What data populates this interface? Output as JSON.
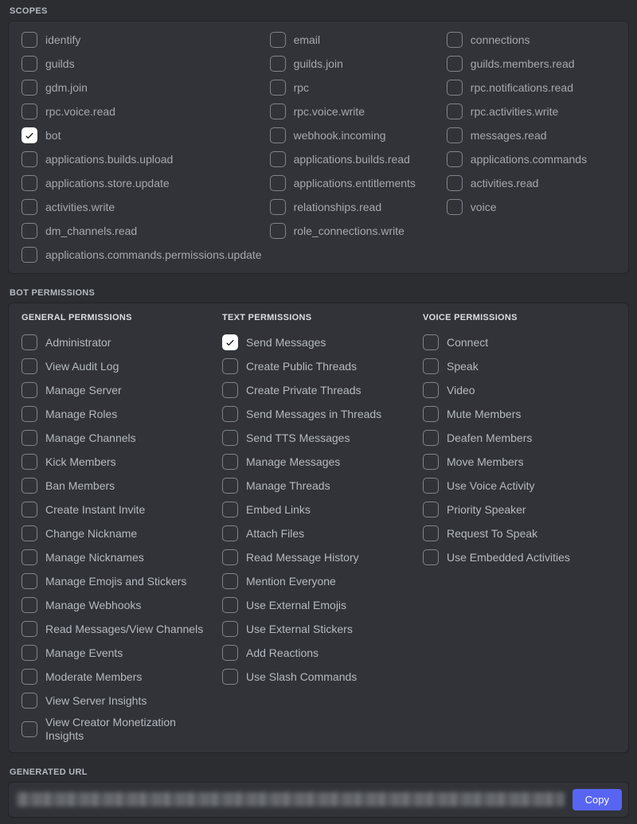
{
  "scopes": {
    "label": "SCOPES",
    "cells": [
      {
        "label": "identify",
        "checked": false
      },
      {
        "label": "email",
        "checked": false
      },
      {
        "label": "connections",
        "checked": false
      },
      {
        "label": "guilds",
        "checked": false
      },
      {
        "label": "guilds.join",
        "checked": false
      },
      {
        "label": "guilds.members.read",
        "checked": false
      },
      {
        "label": "gdm.join",
        "checked": false
      },
      {
        "label": "rpc",
        "checked": false
      },
      {
        "label": "rpc.notifications.read",
        "checked": false
      },
      {
        "label": "rpc.voice.read",
        "checked": false
      },
      {
        "label": "rpc.voice.write",
        "checked": false
      },
      {
        "label": "rpc.activities.write",
        "checked": false
      },
      {
        "label": "bot",
        "checked": true
      },
      {
        "label": "webhook.incoming",
        "checked": false
      },
      {
        "label": "messages.read",
        "checked": false
      },
      {
        "label": "applications.builds.upload",
        "checked": false
      },
      {
        "label": "applications.builds.read",
        "checked": false
      },
      {
        "label": "applications.commands",
        "checked": false
      },
      {
        "label": "applications.store.update",
        "checked": false
      },
      {
        "label": "applications.entitlements",
        "checked": false
      },
      {
        "label": "activities.read",
        "checked": false
      },
      {
        "label": "activities.write",
        "checked": false
      },
      {
        "label": "relationships.read",
        "checked": false
      },
      {
        "label": "voice",
        "checked": false
      },
      {
        "label": "dm_channels.read",
        "checked": false
      },
      {
        "label": "role_connections.write",
        "checked": false
      },
      {
        "label": "",
        "checked": null
      },
      {
        "label": "applications.commands.permissions.update",
        "checked": false
      }
    ]
  },
  "permissions": {
    "label": "BOT PERMISSIONS",
    "columns": [
      {
        "header": "GENERAL PERMISSIONS",
        "items": [
          {
            "label": "Administrator",
            "checked": false
          },
          {
            "label": "View Audit Log",
            "checked": false
          },
          {
            "label": "Manage Server",
            "checked": false
          },
          {
            "label": "Manage Roles",
            "checked": false
          },
          {
            "label": "Manage Channels",
            "checked": false
          },
          {
            "label": "Kick Members",
            "checked": false
          },
          {
            "label": "Ban Members",
            "checked": false
          },
          {
            "label": "Create Instant Invite",
            "checked": false
          },
          {
            "label": "Change Nickname",
            "checked": false
          },
          {
            "label": "Manage Nicknames",
            "checked": false
          },
          {
            "label": "Manage Emojis and Stickers",
            "checked": false
          },
          {
            "label": "Manage Webhooks",
            "checked": false
          },
          {
            "label": "Read Messages/View Channels",
            "checked": false
          },
          {
            "label": "Manage Events",
            "checked": false
          },
          {
            "label": "Moderate Members",
            "checked": false
          },
          {
            "label": "View Server Insights",
            "checked": false
          },
          {
            "label": "View Creator Monetization Insights",
            "checked": false
          }
        ]
      },
      {
        "header": "TEXT PERMISSIONS",
        "items": [
          {
            "label": "Send Messages",
            "checked": true
          },
          {
            "label": "Create Public Threads",
            "checked": false
          },
          {
            "label": "Create Private Threads",
            "checked": false
          },
          {
            "label": "Send Messages in Threads",
            "checked": false
          },
          {
            "label": "Send TTS Messages",
            "checked": false
          },
          {
            "label": "Manage Messages",
            "checked": false
          },
          {
            "label": "Manage Threads",
            "checked": false
          },
          {
            "label": "Embed Links",
            "checked": false
          },
          {
            "label": "Attach Files",
            "checked": false
          },
          {
            "label": "Read Message History",
            "checked": false
          },
          {
            "label": "Mention Everyone",
            "checked": false
          },
          {
            "label": "Use External Emojis",
            "checked": false
          },
          {
            "label": "Use External Stickers",
            "checked": false
          },
          {
            "label": "Add Reactions",
            "checked": false
          },
          {
            "label": "Use Slash Commands",
            "checked": false
          }
        ]
      },
      {
        "header": "VOICE PERMISSIONS",
        "items": [
          {
            "label": "Connect",
            "checked": false
          },
          {
            "label": "Speak",
            "checked": false
          },
          {
            "label": "Video",
            "checked": false
          },
          {
            "label": "Mute Members",
            "checked": false
          },
          {
            "label": "Deafen Members",
            "checked": false
          },
          {
            "label": "Move Members",
            "checked": false
          },
          {
            "label": "Use Voice Activity",
            "checked": false
          },
          {
            "label": "Priority Speaker",
            "checked": false
          },
          {
            "label": "Request To Speak",
            "checked": false
          },
          {
            "label": "Use Embedded Activities",
            "checked": false
          }
        ]
      }
    ]
  },
  "generated_url": {
    "label": "GENERATED URL",
    "copy_label": "Copy"
  }
}
